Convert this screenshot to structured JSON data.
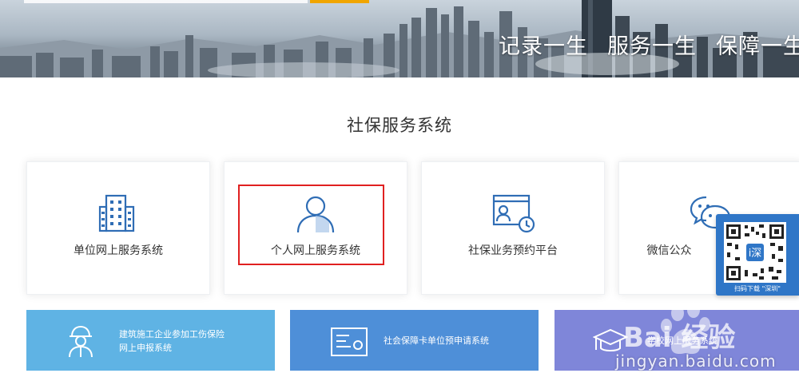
{
  "banner": {
    "slogan": [
      "记录一生",
      "服务一生",
      "保障一生"
    ]
  },
  "section": {
    "title": "社保服务系统"
  },
  "cards": [
    {
      "label": "单位网上服务系统",
      "icon": "building-icon"
    },
    {
      "label": "个人网上服务系统",
      "icon": "user-icon"
    },
    {
      "label": "社保业务预约平台",
      "icon": "calendar-clock-icon"
    },
    {
      "label": "微信公众",
      "icon": "wechat-icon"
    }
  ],
  "qr": {
    "caption": "扫码下载 \"深圳\"",
    "center_char": "i深"
  },
  "tiles": [
    {
      "line1": "建筑施工企业参加工伤保险",
      "line2": "网上申报系统",
      "icon": "worker-icon",
      "color": "#5fb3e4"
    },
    {
      "line1": "社会保障卡单位预申请系统",
      "icon": "card-icon",
      "color": "#4e8fd8"
    },
    {
      "line1": "学校网上服务系统",
      "icon": "graduation-cap-icon",
      "color": "#7f86d9"
    }
  ],
  "watermark": {
    "logo": "Bai 经验",
    "url": "jingyan.baidu.com"
  },
  "colors": {
    "accent_blue": "#2f6db5",
    "highlight_red": "#e02020",
    "search_button": "#f0a500"
  }
}
